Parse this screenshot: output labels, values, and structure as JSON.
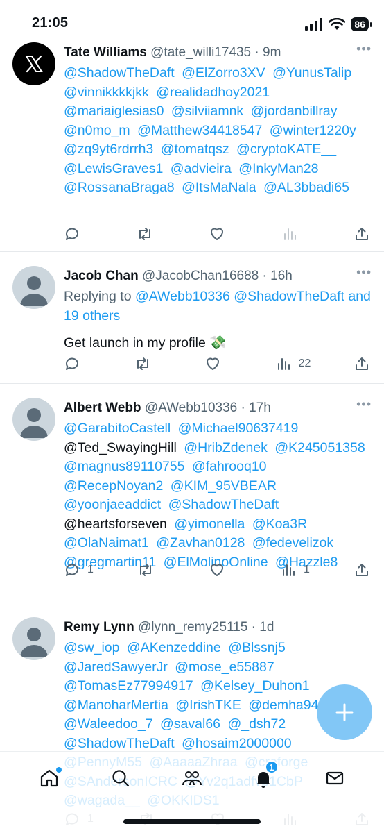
{
  "status_bar": {
    "time": "21:05",
    "battery": "86"
  },
  "tweets": [
    {
      "name": "Tate Williams",
      "handle": "@tate_willi17435",
      "time": "9m",
      "avatar": "x-logo",
      "mentions": [
        "@ShadowTheDaft",
        "@ElZorro3XV",
        "@YunusTalip",
        "@vinnikkkkjkk",
        "@realidadhoy2021",
        "@mariaiglesias0",
        "@silviiamnk",
        "@jordanbillray",
        "@n0mo_m",
        "@Matthew34418547",
        "@winter1220y",
        "@zq9yt6rdrrh3",
        "@tomatqsz",
        "@cryptoKATE__",
        "@LewisGraves1",
        "@advieira",
        "@InkyMan28",
        "@RossanaBraga8",
        "@ItsMaNala",
        "@AL3bbadi65"
      ],
      "counts": {
        "reply": "",
        "retweet": "",
        "like": "",
        "views": ""
      }
    },
    {
      "name": "Jacob Chan",
      "handle": "@JacobChan16688",
      "time": "16h",
      "reply_prefix": "Replying to",
      "reply_to": [
        "@AWebb10336",
        "@ShadowTheDaft"
      ],
      "reply_others": "and 19 others",
      "text": "Get launch in my profile 💸",
      "counts": {
        "reply": "",
        "retweet": "",
        "like": "",
        "views": "22"
      }
    },
    {
      "name": "Albert Webb",
      "handle": "@AWebb10336",
      "time": "17h",
      "mentions_mixed": [
        {
          "t": "@GarabitoCastell",
          "link": true
        },
        {
          "t": "@Michael90637419",
          "link": true
        },
        {
          "t": "@Ted_SwayingHill",
          "link": false
        },
        {
          "t": "@HribZdenek",
          "link": true
        },
        {
          "t": "@K245051358",
          "link": true
        },
        {
          "t": "@magnus89110755",
          "link": true
        },
        {
          "t": "@fahrooq10",
          "link": true
        },
        {
          "t": "@RecepNoyan2",
          "link": true
        },
        {
          "t": "@KIM_95VBEAR",
          "link": true
        },
        {
          "t": "@yoonjaeaddict",
          "link": true
        },
        {
          "t": "@ShadowTheDaft",
          "link": true
        },
        {
          "t": "@heartsforseven",
          "link": false
        },
        {
          "t": "@yimonella",
          "link": true
        },
        {
          "t": "@Koa3R",
          "link": true
        },
        {
          "t": "@OlaNaimat1",
          "link": true
        },
        {
          "t": "@Zavhan0128",
          "link": true
        },
        {
          "t": "@fedevelizok",
          "link": true
        },
        {
          "t": "@gregmartin11",
          "link": true
        },
        {
          "t": "@ElMolinoOnline",
          "link": true
        },
        {
          "t": "@Hazzle8",
          "link": true
        }
      ],
      "counts": {
        "reply": "1",
        "retweet": "",
        "like": "",
        "views": "1"
      }
    },
    {
      "name": "Remy Lynn",
      "handle": "@lynn_remy25115",
      "time": "1d",
      "mentions": [
        "@sw_iop",
        "@AKenzeddine",
        "@Blssnj5",
        "@JaredSawyerJr",
        "@mose_e55887",
        "@TomasEz77994917",
        "@Kelsey_Duhon1",
        "@ManoharMertia",
        "@IrishTKE",
        "@demha94",
        "@Waleedoo_7",
        "@saval66",
        "@_dsh72",
        "@ShadowTheDaft",
        "@hosaim2000000",
        "@PennyM55",
        "@AaaaaZhraa",
        "@creforge",
        "@SAndersonICRC",
        "@Yv2q1adfvb1CbP",
        "@wagada__",
        "@OKKIDS1"
      ],
      "counts": {
        "reply": "1",
        "retweet": "",
        "like": "",
        "views": ""
      }
    }
  ],
  "bottom_nav": {
    "items": [
      "home-icon",
      "search-icon",
      "communities-icon",
      "notifications-icon",
      "messages-icon"
    ],
    "notification_badge": "1"
  },
  "colors": {
    "accent": "#1d9bf0",
    "text": "#0f1419",
    "muted": "#536471"
  }
}
